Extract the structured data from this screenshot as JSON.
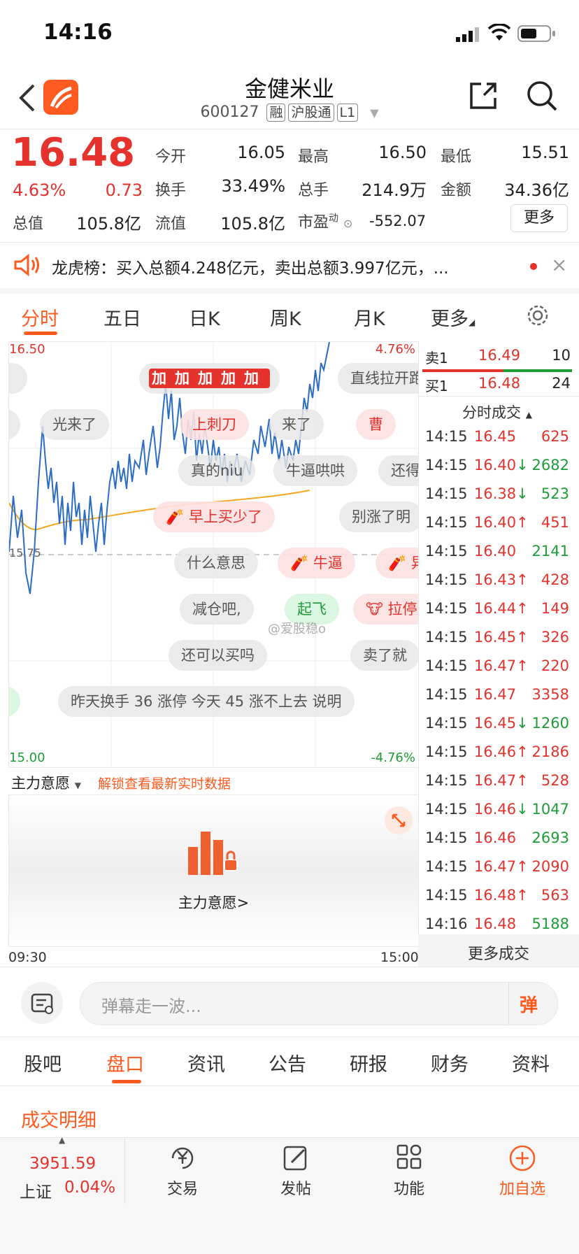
{
  "status_bar": {
    "time": "14:16"
  },
  "header": {
    "title": "金健米业",
    "code": "600127",
    "tags": [
      "融",
      "沪股通",
      "L1"
    ]
  },
  "quote": {
    "price": "16.48",
    "change_pct": "4.63%",
    "change_amt": "0.73",
    "stats": {
      "open_label": "今开",
      "open": "16.05",
      "high_label": "最高",
      "high": "16.50",
      "low_label": "最低",
      "low": "15.51",
      "turnover_label": "换手",
      "turnover": "33.49%",
      "volume_label": "总手",
      "volume": "214.9万",
      "amount_label": "金额",
      "amount": "34.36亿",
      "mktcap_label": "总值",
      "mktcap": "105.8亿",
      "float_label": "流值",
      "float": "105.8亿",
      "pe_label": "市盈",
      "pe_sup": "动",
      "pe": "-552.07"
    },
    "more_button": "更多"
  },
  "notice": {
    "text": "龙虎榜：买入总额4.248亿元，卖出总额3.997亿元，..."
  },
  "chart_tabs": [
    "分时",
    "五日",
    "日K",
    "周K",
    "月K",
    "更多"
  ],
  "active_chart_tab": 0,
  "chart": {
    "y_top": "16.50",
    "y_mid": "15.75",
    "y_bottom": "15.00",
    "pct_top": "4.76%",
    "pct_bottom": "-4.76%",
    "x_start": "09:30",
    "x_end": "15:00",
    "watermark": "@爱股稳o"
  },
  "danmaku": [
    {
      "text": "加加加加加",
      "style": "stamp"
    },
    {
      "text": "直线拉开跑",
      "style": "gray"
    },
    {
      "text": "光来了",
      "style": "gray"
    },
    {
      "text": "上刺刀",
      "style": "pink"
    },
    {
      "text": "来了",
      "style": "gray"
    },
    {
      "text": "曹",
      "style": "pink"
    },
    {
      "text": "真的niu",
      "style": "gray"
    },
    {
      "text": "牛逼哄哄",
      "style": "gray"
    },
    {
      "text": "还得",
      "style": "gray"
    },
    {
      "text": "早上买少了",
      "style": "pink"
    },
    {
      "text": "别涨了明",
      "style": "gray"
    },
    {
      "text": "什么意思",
      "style": "gray"
    },
    {
      "text": "牛逼",
      "style": "pink"
    },
    {
      "text": "异",
      "style": "pink"
    },
    {
      "text": "减仓吧,",
      "style": "gray"
    },
    {
      "text": "起飞",
      "style": "mint"
    },
    {
      "text": "拉停",
      "style": "pink"
    },
    {
      "text": "还可以买吗",
      "style": "gray"
    },
    {
      "text": "卖了就",
      "style": "gray"
    },
    {
      "text": "昨天换手 36 涨停 今天 45 涨不上去 说明",
      "style": "gray"
    }
  ],
  "order_book": [
    {
      "side": "卖1",
      "price": "16.49",
      "qty": "10"
    },
    {
      "side": "买1",
      "price": "16.48",
      "qty": "24"
    }
  ],
  "trades_header": "分时成交",
  "trades": [
    {
      "time": "14:15",
      "price": "16.45",
      "arrow": "",
      "vol": "625",
      "color": "red"
    },
    {
      "time": "14:15",
      "price": "16.40",
      "arrow": "↓",
      "vol": "2682",
      "color": "green"
    },
    {
      "time": "14:15",
      "price": "16.38",
      "arrow": "↓",
      "vol": "523",
      "color": "green"
    },
    {
      "time": "14:15",
      "price": "16.40",
      "arrow": "↑",
      "vol": "451",
      "color": "red"
    },
    {
      "time": "14:15",
      "price": "16.40",
      "arrow": "",
      "vol": "2141",
      "color": "green"
    },
    {
      "time": "14:15",
      "price": "16.43",
      "arrow": "↑",
      "vol": "428",
      "color": "red"
    },
    {
      "time": "14:15",
      "price": "16.44",
      "arrow": "↑",
      "vol": "149",
      "color": "red"
    },
    {
      "time": "14:15",
      "price": "16.45",
      "arrow": "↑",
      "vol": "326",
      "color": "red"
    },
    {
      "time": "14:15",
      "price": "16.47",
      "arrow": "↑",
      "vol": "220",
      "color": "red"
    },
    {
      "time": "14:15",
      "price": "16.47",
      "arrow": "",
      "vol": "3358",
      "color": "red"
    },
    {
      "time": "14:15",
      "price": "16.45",
      "arrow": "↓",
      "vol": "1260",
      "color": "green"
    },
    {
      "time": "14:15",
      "price": "16.46",
      "arrow": "↑",
      "vol": "2186",
      "color": "red"
    },
    {
      "time": "14:15",
      "price": "16.47",
      "arrow": "↑",
      "vol": "528",
      "color": "red"
    },
    {
      "time": "14:15",
      "price": "16.46",
      "arrow": "↓",
      "vol": "1047",
      "color": "green"
    },
    {
      "time": "14:15",
      "price": "16.46",
      "arrow": "",
      "vol": "2693",
      "color": "green"
    },
    {
      "time": "14:15",
      "price": "16.47",
      "arrow": "↑",
      "vol": "2090",
      "color": "red"
    },
    {
      "time": "14:15",
      "price": "16.48",
      "arrow": "↑",
      "vol": "563",
      "color": "red"
    },
    {
      "time": "14:16",
      "price": "16.48",
      "arrow": "",
      "vol": "5188",
      "color": "green"
    }
  ],
  "more_trades": "更多成交",
  "indicator": {
    "dropdown": "主力意愿",
    "unlock": "解锁查看最新实时数据",
    "center_label": "主力意愿>"
  },
  "comment_input": {
    "placeholder": "弹幕走一波...",
    "send": "弹"
  },
  "bottom_tabs": [
    "股吧",
    "盘口",
    "资讯",
    "公告",
    "研报",
    "财务",
    "资料"
  ],
  "active_bottom_tab": 1,
  "section_title": "成交明细",
  "nav": {
    "index_value": "3951.59",
    "index_name": "上证",
    "index_pct": "0.04%",
    "items": [
      "交易",
      "发帖",
      "功能",
      "加自选"
    ]
  },
  "colors": {
    "red": "#e5322d",
    "green": "#1e9c3a",
    "orange": "#ff5a1f",
    "avg_line": "#f5a623",
    "price_line": "#2b6cc4"
  }
}
